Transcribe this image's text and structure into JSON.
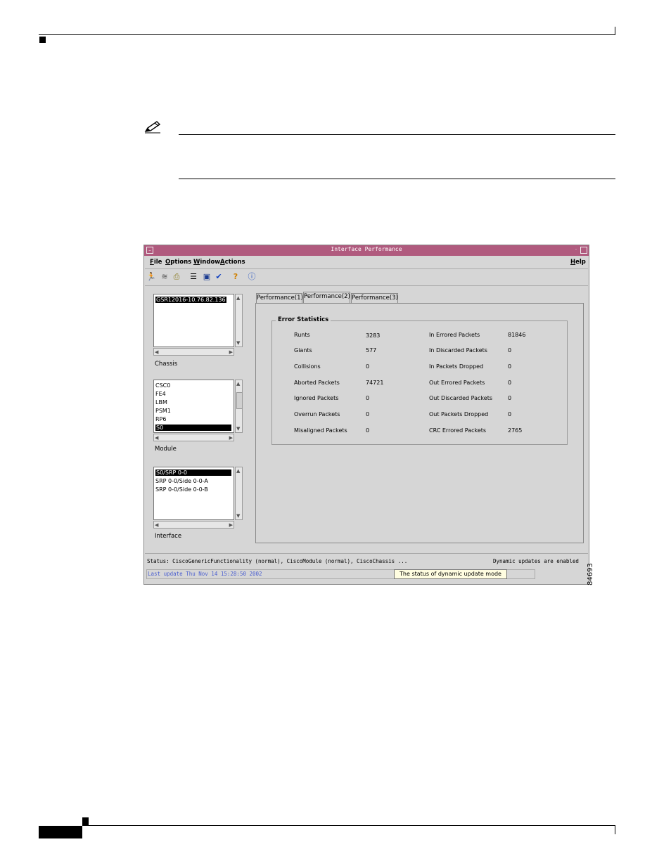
{
  "window": {
    "title": "Interface Performance",
    "menus": [
      {
        "label": "File",
        "u": "F",
        "rest": "ile"
      },
      {
        "label": "Options",
        "u": "O",
        "rest": "ptions"
      },
      {
        "label": "Window",
        "u": "W",
        "rest": "indow"
      },
      {
        "label": "Actions",
        "u": "A",
        "rest": "ctions"
      },
      {
        "label": "Help",
        "u": "H",
        "rest": "elp"
      }
    ],
    "toolbar_icons": [
      "exit-icon",
      "layers-icon",
      "printer-icon",
      "list-icon",
      "monitor-icon",
      "checkmark-icon",
      "help-icon",
      "info-icon"
    ]
  },
  "chassis": {
    "label": "Chassis",
    "items": [
      "GSR12016-10.76.82.136"
    ],
    "selected": 0
  },
  "module": {
    "label": "Module",
    "items": [
      "CSC0",
      "FE4",
      "LBM",
      "PSM1",
      "RP6",
      "S0"
    ],
    "selected": 5
  },
  "interface": {
    "label": "Interface",
    "items": [
      "S0/SRP 0-0",
      "SRP 0-0/Side 0-0-A",
      "SRP 0-0/Side 0-0-B"
    ],
    "selected": 0
  },
  "tabs": [
    "Performance(1)",
    "Performance(2)",
    "Performance(3)"
  ],
  "active_tab": 1,
  "error_statistics": {
    "title": "Error Statistics",
    "left": [
      {
        "label": "Runts",
        "value": "3283"
      },
      {
        "label": "Giants",
        "value": "577"
      },
      {
        "label": "Collisions",
        "value": "0"
      },
      {
        "label": "Aborted Packets",
        "value": "74721"
      },
      {
        "label": "Ignored Packets",
        "value": "0"
      },
      {
        "label": "Overrun Packets",
        "value": "0"
      },
      {
        "label": "Misaligned Packets",
        "value": "0"
      }
    ],
    "right": [
      {
        "label": "In Errored Packets",
        "value": "81846"
      },
      {
        "label": "In Discarded Packets",
        "value": "0"
      },
      {
        "label": "In Packets Dropped",
        "value": "0"
      },
      {
        "label": "Out Errored Packets",
        "value": "0"
      },
      {
        "label": "Out Discarded Packets",
        "value": "0"
      },
      {
        "label": "Out Packets Dropped",
        "value": "0"
      },
      {
        "label": "CRC Errored Packets",
        "value": "2765"
      }
    ]
  },
  "status": {
    "text": "Status: CiscoGenericFunctionality (normal), CiscoModule (normal), CiscoChassis ...",
    "dynamic": "Dynamic updates are enabled",
    "last_update": "Last update Thu Nov 14 15:28:50 2002",
    "tooltip": "The status of dynamic update mode"
  },
  "figure_id": "84693",
  "colors": {
    "titlebar": "#b05a7e",
    "last_update_text": "#4b5fd0",
    "tooltip_bg": "#fffde0"
  }
}
